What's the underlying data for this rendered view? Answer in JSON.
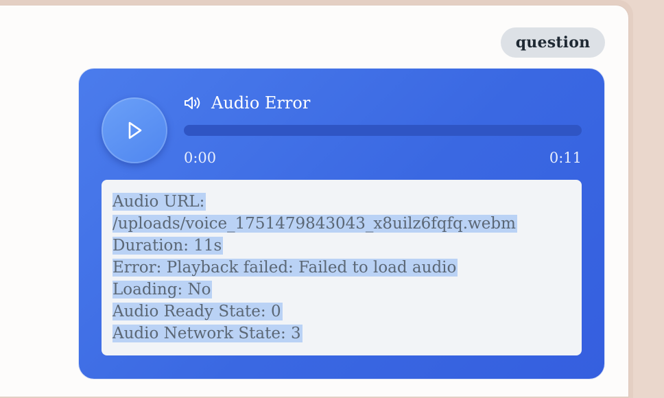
{
  "message": {
    "role_badge": "question"
  },
  "audio_player": {
    "title": "Audio Error",
    "speaker_icon": "speaker-icon",
    "play_icon": "play-icon",
    "current_time": "0:00",
    "total_time": "0:11",
    "progress_fraction": 0
  },
  "debug_info": {
    "lines": [
      "Audio URL:",
      "/uploads/voice_1751479843043_x8uilz6fqfq.webm",
      "Duration: 11s",
      "Error: Playback failed: Failed to load audio",
      "Loading: No",
      "Audio Ready State: 0",
      "Audio Network State: 3"
    ]
  },
  "colors": {
    "bubble": "#3f6fe6",
    "badge_background": "#dde1e6",
    "debug_background": "#f2f4f7",
    "text_selection": "#bad2f5"
  }
}
